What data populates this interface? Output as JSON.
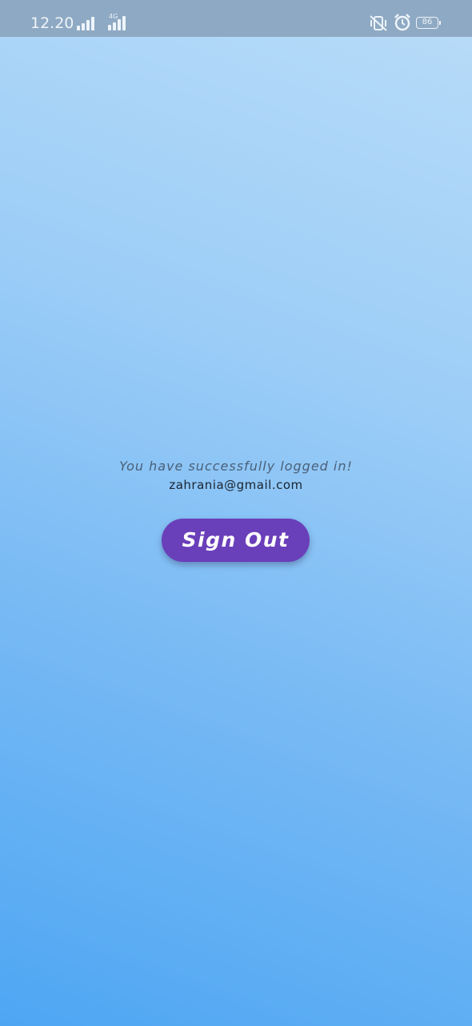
{
  "status_bar": {
    "time": "12.20",
    "network_label": "4G",
    "battery_level": "86",
    "icons": [
      "signal-icon",
      "signal-4g-icon",
      "vibrate-mute-icon",
      "alarm-icon",
      "battery-icon"
    ]
  },
  "main": {
    "message": "You have successfully logged in!",
    "email": "zahrania@gmail.com",
    "signout_label": "Sign Out"
  },
  "colors": {
    "button": "#6a3fba",
    "background_top": "#b9dcf8",
    "background_bottom": "#4ea6f3",
    "status_bar": "#8ea9c3"
  }
}
